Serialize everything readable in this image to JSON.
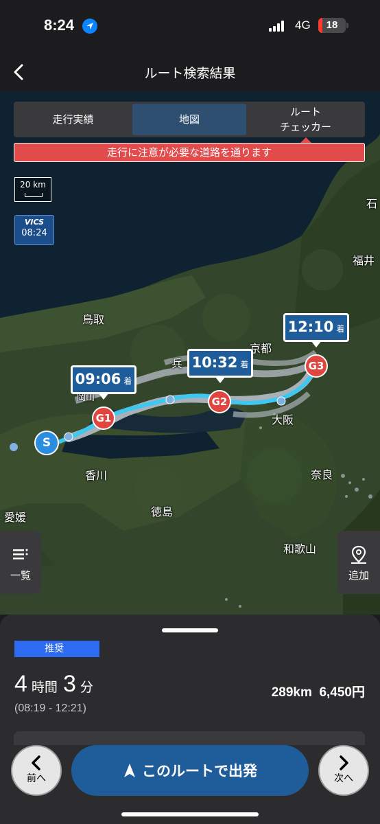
{
  "status": {
    "time": "8:24",
    "network": "4G",
    "battery": "18"
  },
  "nav": {
    "title": "ルート検索結果"
  },
  "segments": [
    {
      "label": "走行実績"
    },
    {
      "label": "地図"
    },
    {
      "label": "ルート\nチェッカー"
    }
  ],
  "warning": "走行に注意が必要な道路を通ります",
  "scale": "20 km",
  "vics": {
    "logo": "VICS",
    "time": "08:24"
  },
  "places": [
    "鳥取",
    "岡山",
    "兵",
    "京都",
    "大阪",
    "香川",
    "徳島",
    "奈良",
    "和歌山",
    "愛媛",
    "福井",
    "石"
  ],
  "callouts": [
    {
      "time": "09:06",
      "suffix": "着"
    },
    {
      "time": "10:32",
      "suffix": "着"
    },
    {
      "time": "12:10",
      "suffix": "着"
    }
  ],
  "pins": {
    "start": "S",
    "g1": "G1",
    "g2": "G2",
    "g3": "G3"
  },
  "side": {
    "list": "一覧",
    "add": "追加"
  },
  "summary": {
    "badge": "推奨",
    "hours": "4",
    "hours_unit": "時間",
    "minutes": "3",
    "minutes_unit": "分",
    "range": "(08:19 - 12:21)",
    "distance_fare": "289km  6,450円"
  },
  "actions": {
    "prev": "前へ",
    "go": "このルートで出発",
    "next": "次へ"
  },
  "colors": {
    "accent": "#1f5d9a",
    "warning": "#e24b4b",
    "goal": "#e0453f",
    "start": "#2a8de0",
    "route": "#3ec8f0"
  }
}
